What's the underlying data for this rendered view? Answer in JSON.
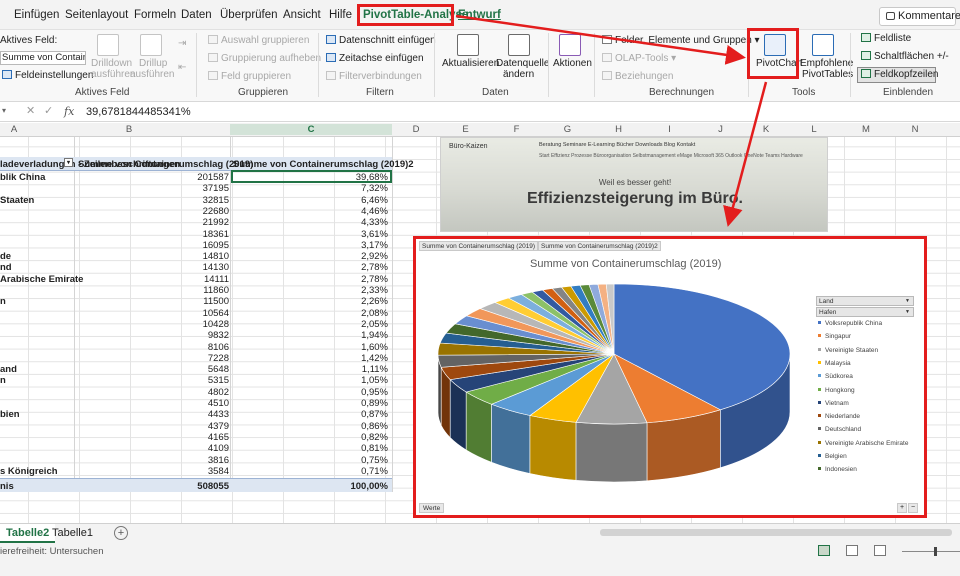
{
  "menubar": {
    "tabs": [
      {
        "label": "Einfügen"
      },
      {
        "label": "Seitenlayout"
      },
      {
        "label": "Formeln"
      },
      {
        "label": "Daten"
      },
      {
        "label": "Überprüfen"
      },
      {
        "label": "Ansicht"
      },
      {
        "label": "Hilfe"
      },
      {
        "label": "PivotTable-Analyse"
      },
      {
        "label": "Entwurf"
      }
    ],
    "comments_label": "Kommentare"
  },
  "ribbon": {
    "active_field": {
      "label": "Aktives Feld:",
      "value": "Summe von Containen",
      "settings": "Feldeinstellungen",
      "drilldown": "Drilldown",
      "drilldown2": "ausführen",
      "drillup": "Drillup",
      "drillup2": "ausführen",
      "group": "Aktives Feld"
    },
    "grouping": {
      "items": [
        "Auswahl gruppieren",
        "Gruppierung aufheben",
        "Feld gruppieren"
      ],
      "group": "Gruppieren"
    },
    "filter": {
      "items": [
        "Datenschnitt einfügen",
        "Zeitachse einfügen",
        "Filterverbindungen"
      ],
      "group": "Filtern"
    },
    "data": {
      "refresh": "Aktualisieren",
      "source1": "Datenquelle",
      "source2": "ändern",
      "group": "Daten"
    },
    "actions": {
      "label": "Aktionen"
    },
    "calculations": {
      "items": [
        "Felder, Elemente und Gruppen",
        "OLAP-Tools",
        "Beziehungen"
      ],
      "group": "Berechnungen"
    },
    "tools": {
      "pivotchart": "PivotChart",
      "recommended1": "Empfohlene",
      "recommended2": "PivotTables",
      "group": "Tools"
    },
    "show": {
      "items": [
        "Feldliste",
        "Schaltflächen +/-",
        "Feldkopfzeilen"
      ],
      "group": "Einblenden"
    }
  },
  "formula_bar": {
    "fx": "fx",
    "value": "39,6781844485341%"
  },
  "columns": [
    "A",
    "B",
    "C",
    "D",
    "E",
    "F",
    "G",
    "H",
    "I",
    "J",
    "K",
    "L",
    "M",
    "N"
  ],
  "pivot": {
    "headers": [
      "ladeverladungen - Zeilenbeschriftungen",
      "Summe von Containerumschlag (2019)",
      "Summe von Containerumschlag (2019)2"
    ],
    "rows": [
      {
        "label": "blik China",
        "v1": "201587",
        "v2": "39,68%"
      },
      {
        "label": "",
        "v1": "37195",
        "v2": "7,32%"
      },
      {
        "label": "Staaten",
        "v1": "32815",
        "v2": "6,46%"
      },
      {
        "label": "",
        "v1": "22680",
        "v2": "4,46%"
      },
      {
        "label": "",
        "v1": "21992",
        "v2": "4,33%"
      },
      {
        "label": "",
        "v1": "18361",
        "v2": "3,61%"
      },
      {
        "label": "",
        "v1": "16095",
        "v2": "3,17%"
      },
      {
        "label": "de",
        "v1": "14810",
        "v2": "2,92%"
      },
      {
        "label": "nd",
        "v1": "14130",
        "v2": "2,78%"
      },
      {
        "label": "Arabische Emirate",
        "v1": "14111",
        "v2": "2,78%"
      },
      {
        "label": "",
        "v1": "11860",
        "v2": "2,33%"
      },
      {
        "label": "n",
        "v1": "11500",
        "v2": "2,26%"
      },
      {
        "label": "",
        "v1": "10564",
        "v2": "2,08%"
      },
      {
        "label": "",
        "v1": "10428",
        "v2": "2,05%"
      },
      {
        "label": "",
        "v1": "9832",
        "v2": "1,94%"
      },
      {
        "label": "",
        "v1": "8106",
        "v2": "1,60%"
      },
      {
        "label": "",
        "v1": "7228",
        "v2": "1,42%"
      },
      {
        "label": "and",
        "v1": "5648",
        "v2": "1,11%"
      },
      {
        "label": "n",
        "v1": "5315",
        "v2": "1,05%"
      },
      {
        "label": "",
        "v1": "4802",
        "v2": "0,95%"
      },
      {
        "label": "",
        "v1": "4510",
        "v2": "0,89%"
      },
      {
        "label": "bien",
        "v1": "4433",
        "v2": "0,87%"
      },
      {
        "label": "",
        "v1": "4379",
        "v2": "0,86%"
      },
      {
        "label": "",
        "v1": "4165",
        "v2": "0,82%"
      },
      {
        "label": "",
        "v1": "4109",
        "v2": "0,81%"
      },
      {
        "label": "",
        "v1": "3816",
        "v2": "0,75%"
      },
      {
        "label": "s Königreich",
        "v1": "3584",
        "v2": "0,71%"
      }
    ],
    "total": {
      "label": "nis",
      "v1": "508055",
      "v2": "100,00%"
    }
  },
  "overlay": {
    "brand": "Büro-Kaizen",
    "nav": "Beratung   Seminare   E-Learning   Bücher   Downloads   Blog   Kontakt",
    "sub": "Start  Effizienz  Prozesse  Büroorganisation  Selbstmanagement  eMage  Microsoft 365  Outlook  OneNote  Teams  Hardware",
    "tagline": "Weil es besser geht!",
    "title": "Effizienzsteigerung im Büro."
  },
  "chart": {
    "field_buttons": [
      "Summe von Containerumschlag (2019)",
      "Summe von Containerumschlag (2019)2"
    ],
    "legend_dropdowns": [
      "Land",
      "Hafen"
    ],
    "werte_label": "Werte",
    "plus": "+",
    "minus": "−"
  },
  "chart_data": {
    "type": "pie",
    "title": "Summe von Containerumschlag (2019)",
    "legend_position": "right",
    "slices": [
      {
        "name": "Volksrepublik China",
        "value": 201587,
        "color": "#4472c4"
      },
      {
        "name": "Singapur",
        "value": 37195,
        "color": "#ed7d31"
      },
      {
        "name": "Vereinigte Staaten",
        "value": 32815,
        "color": "#a5a5a5"
      },
      {
        "name": "Malaysia",
        "value": 22680,
        "color": "#ffc000"
      },
      {
        "name": "Südkorea",
        "value": 21992,
        "color": "#5b9bd5"
      },
      {
        "name": "Hongkong",
        "value": 18361,
        "color": "#70ad47"
      },
      {
        "name": "Vietnam",
        "value": 16095,
        "color": "#264478"
      },
      {
        "name": "Niederlande",
        "value": 14810,
        "color": "#9e480e"
      },
      {
        "name": "Deutschland",
        "value": 14130,
        "color": "#636363"
      },
      {
        "name": "Vereinigte Arabische Emirate",
        "value": 14111,
        "color": "#997300"
      },
      {
        "name": "Belgien",
        "value": 11860,
        "color": "#255e91"
      },
      {
        "name": "Indonesien",
        "value": 11500,
        "color": "#43682b"
      },
      {
        "value": 10564,
        "color": "#698ed0"
      },
      {
        "value": 10428,
        "color": "#f1975a"
      },
      {
        "value": 9832,
        "color": "#b7b7b7"
      },
      {
        "value": 8106,
        "color": "#ffcd33"
      },
      {
        "value": 7228,
        "color": "#7cafdd"
      },
      {
        "value": 5648,
        "color": "#8cc168"
      },
      {
        "value": 5315,
        "color": "#335aa1"
      },
      {
        "value": 4802,
        "color": "#d26012"
      },
      {
        "value": 4510,
        "color": "#848484"
      },
      {
        "value": 4433,
        "color": "#cc9a00"
      },
      {
        "value": 4379,
        "color": "#327dc2"
      },
      {
        "value": 4165,
        "color": "#5a8a39"
      },
      {
        "value": 4109,
        "color": "#8faadc"
      },
      {
        "value": 3816,
        "color": "#f4b183"
      },
      {
        "value": 3584,
        "color": "#c9c9c9"
      }
    ]
  },
  "sheets": {
    "tabs": [
      "Tabelle2",
      "Tabelle1"
    ],
    "add": "+"
  },
  "status": {
    "text": "ierefreiheit: Untersuchen"
  }
}
